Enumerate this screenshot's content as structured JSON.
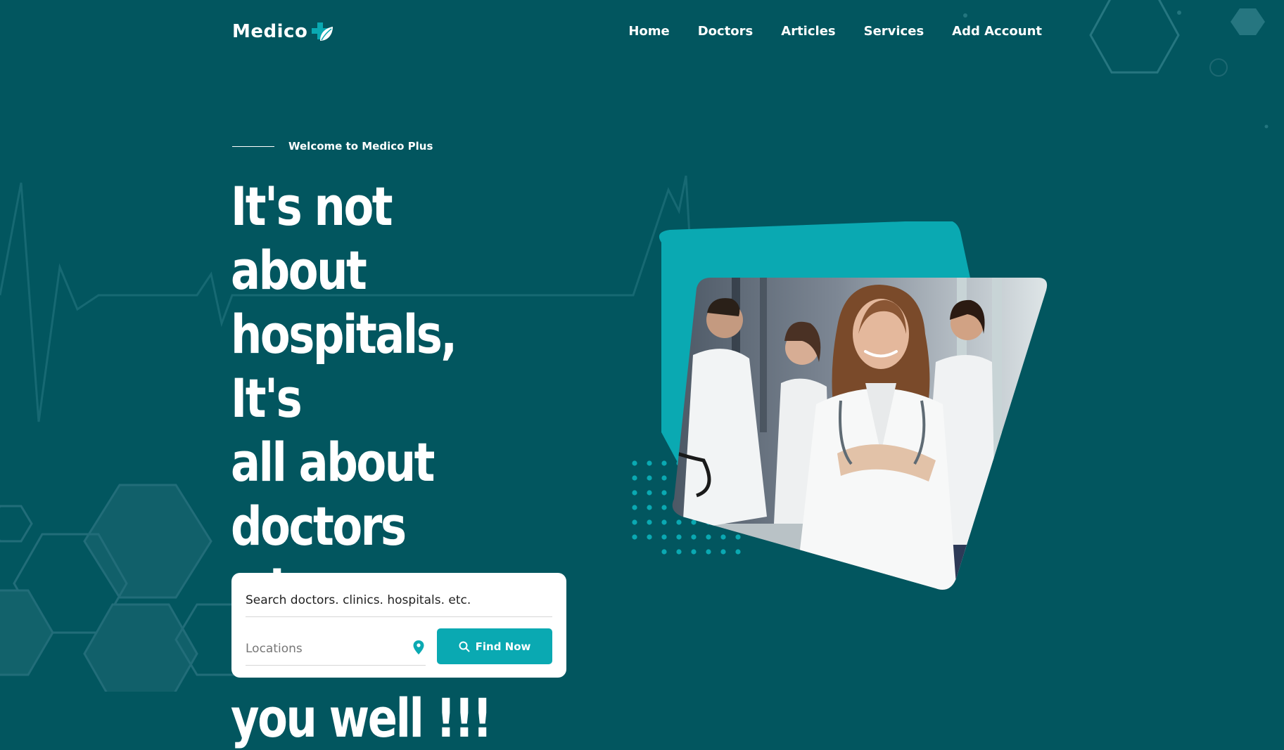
{
  "brand": {
    "name": "Medico",
    "accent": "#0aa9b2",
    "background": "#02565f"
  },
  "nav": {
    "items": [
      {
        "label": "Home"
      },
      {
        "label": "Doctors"
      },
      {
        "label": "Articles"
      },
      {
        "label": "Services"
      },
      {
        "label": "Add Account"
      }
    ]
  },
  "hero": {
    "eyebrow": "Welcome to Medico Plus",
    "headline": "It's not about\nhospitals, It's\nall about\ndoctors who\ncan treat\nyou well !!!",
    "image_icon": "doctors-photo"
  },
  "search": {
    "query_placeholder": "Search doctors. clinics. hospitals. etc.",
    "location_placeholder": "Locations",
    "location_icon": "map-pin-icon",
    "button_label": "Find Now",
    "button_icon": "search-icon"
  }
}
